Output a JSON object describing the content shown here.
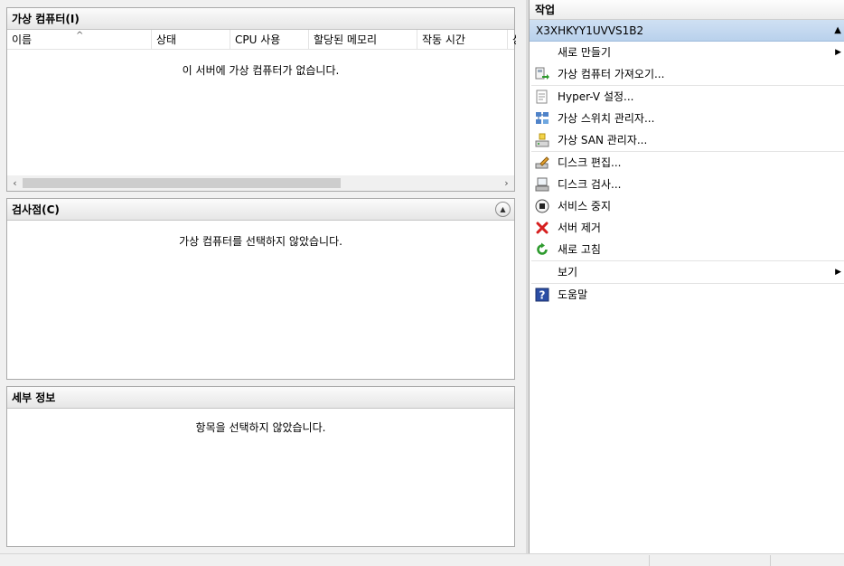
{
  "vm_panel": {
    "title": "가상 컴퓨터(I)",
    "columns": [
      "이름",
      "상태",
      "CPU 사용",
      "할당된 메모리",
      "작동 시간",
      "상"
    ],
    "empty_message": "이 서버에 가상 컴퓨터가 없습니다."
  },
  "checkpoint_panel": {
    "title": "검사점(C)",
    "empty_message": "가상 컴퓨터를 선택하지 않았습니다."
  },
  "details_panel": {
    "title": "세부 정보",
    "empty_message": "항목을 선택하지 않았습니다."
  },
  "actions": {
    "title": "작업",
    "server_name": "X3XHKYY1UVVS1B2",
    "items": [
      {
        "label": "새로 만들기",
        "icon": "none",
        "submenu": true
      },
      {
        "label": "가상 컴퓨터 가져오기...",
        "icon": "import-vm-icon"
      },
      {
        "label": "Hyper-V 설정...",
        "icon": "settings-document-icon"
      },
      {
        "label": "가상 스위치 관리자...",
        "icon": "network-switch-icon"
      },
      {
        "label": "가상 SAN 관리자...",
        "icon": "san-storage-icon"
      },
      {
        "label": "디스크 편집...",
        "icon": "edit-disk-icon"
      },
      {
        "label": "디스크 검사...",
        "icon": "inspect-disk-icon"
      },
      {
        "label": "서비스 중지",
        "icon": "stop-service-icon"
      },
      {
        "label": "서버 제거",
        "icon": "remove-x-icon"
      },
      {
        "label": "새로 고침",
        "icon": "refresh-icon"
      },
      {
        "label": "보기",
        "icon": "none",
        "submenu": true
      },
      {
        "label": "도움말",
        "icon": "help-icon"
      }
    ]
  },
  "colors": {
    "server_row": "#c3d8f0",
    "remove_icon": "#d61f1f",
    "refresh_icon": "#2e9b2e",
    "help_icon": "#2b4ea5"
  }
}
